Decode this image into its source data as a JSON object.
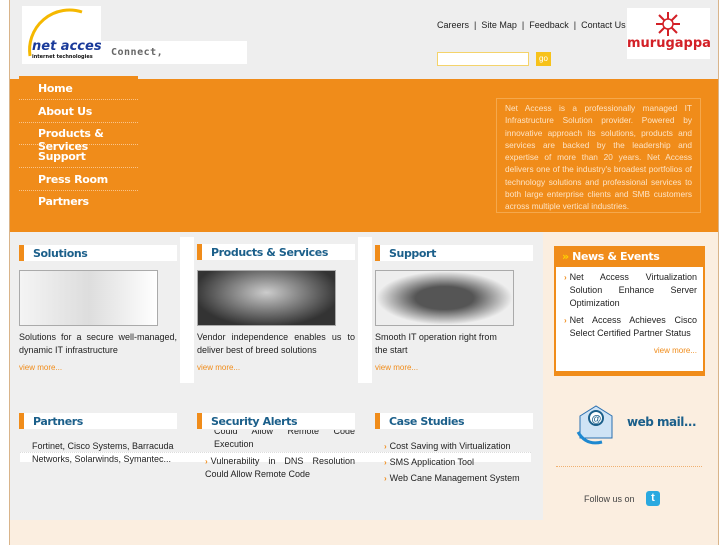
{
  "header": {
    "logo_text": "net access",
    "logo_sub": "internet technologies",
    "tagline": "Connect,",
    "top_links": [
      "Careers",
      "Site Map",
      "Feedback",
      "Contact Us"
    ],
    "search": {
      "value": "",
      "button": "go"
    },
    "partner_logo": "murugappa"
  },
  "nav": [
    "Home",
    "About Us",
    "Products & Services",
    "Support",
    "Press Room",
    "Partners"
  ],
  "intro": "Net Access is a professionally managed IT Infrastructure Solution provider. Powered by innovative approach its solutions, products and services are backed by the leadership and expertise of more than 20 years. Net Access delivers one of the industry's broadest portfolios of technology solutions and professional services to both large enterprise clients and SMB customers across multiple vertical industries.",
  "columns": [
    {
      "title": "Solutions",
      "text": "Solutions for a secure well-managed, dynamic IT infrastructure",
      "more": "view more..."
    },
    {
      "title": "Products & Services",
      "text": "Vendor independence enables us to deliver best of breed solutions",
      "more": "view more..."
    },
    {
      "title": "Support",
      "text": "Smooth IT operation right from the start",
      "more": "view more..."
    }
  ],
  "partners": {
    "title": "Partners",
    "text": "Fortinet, Cisco Systems, Barracuda Networks, Solarwinds, Symantec..."
  },
  "security": {
    "title": "Security Alerts",
    "items": [
      "Could Allow Remote Code Execution",
      "Vulnerability in DNS Resolution Could Allow Remote Code"
    ]
  },
  "cases": {
    "title": "Case Studies",
    "items": [
      "Cost Saving with Virtualization",
      "SMS Application Tool",
      "Web Cane Management System"
    ]
  },
  "news": {
    "title": "News & Events",
    "items": [
      "Net Access Virtualization Solution Enhance Server Optimization",
      "Net Access Achieves Cisco Select Certified Partner Status"
    ],
    "more": "view more..."
  },
  "webmail": "web mail...",
  "follow": "Follow us on",
  "colors": {
    "orange": "#f08c1a",
    "blue": "#1b5f8a"
  }
}
